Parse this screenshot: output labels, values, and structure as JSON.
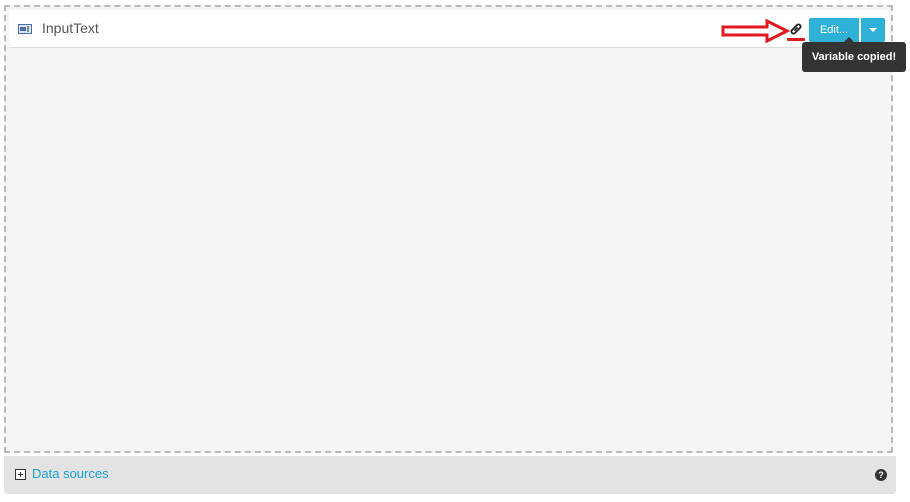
{
  "component": {
    "title": "InputText",
    "icon": "input-text-icon"
  },
  "toolbar": {
    "copy_icon": "link-icon",
    "edit_label": "Edit...",
    "dropdown_icon": "caret-down-icon",
    "accent_color": "#2fb0d6"
  },
  "tooltip": {
    "text": "Variable copied!"
  },
  "annotation": {
    "arrow_color": "#e0191f"
  },
  "footer": {
    "data_sources_label": "Data sources",
    "help_icon_glyph": "?"
  }
}
